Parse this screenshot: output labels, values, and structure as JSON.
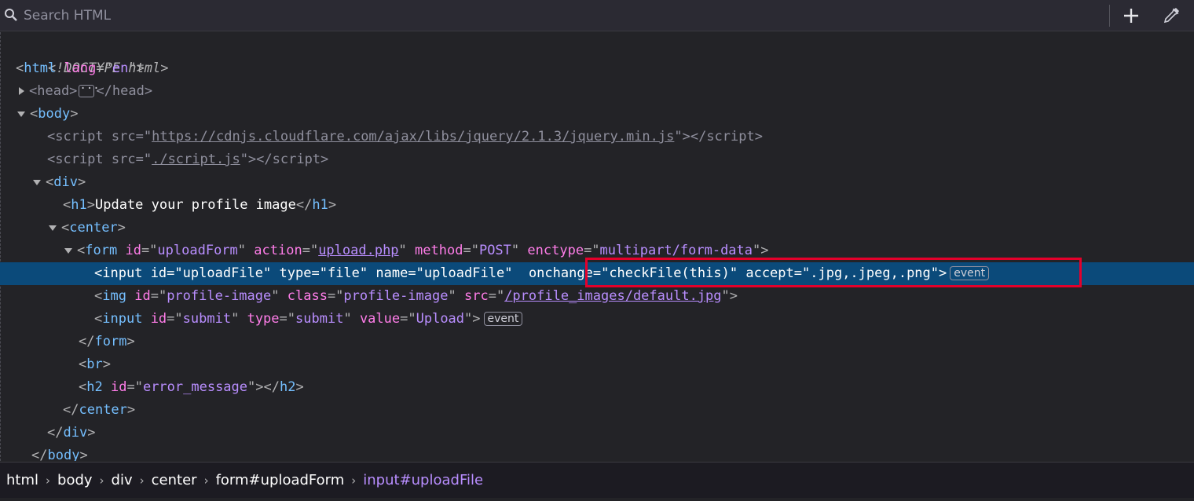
{
  "toolbar": {
    "search_placeholder": "Search HTML",
    "add_label": "+",
    "icons": [
      "search-icon",
      "add-icon",
      "eyedropper-icon"
    ]
  },
  "tree": {
    "doctype": "<!DOCTYPE html>",
    "html_open": "<html lang=\"en\">",
    "html_attr_name": "lang",
    "html_attr_value": "en",
    "head": {
      "open": "<head>",
      "close": "</head>"
    },
    "body_tag": "body",
    "script1": {
      "attr": "src",
      "value": "https://cdnjs.cloudflare.com/ajax/libs/jquery/2.1.3/jquery.min.js"
    },
    "script2": {
      "attr": "src",
      "value": "./script.js"
    },
    "div_tag": "div",
    "h1": {
      "tag": "h1",
      "text": "Update your profile image"
    },
    "center_tag": "center",
    "form": {
      "tag": "form",
      "attrs": [
        {
          "name": "id",
          "value": "uploadForm"
        },
        {
          "name": "action",
          "value": "upload.php"
        },
        {
          "name": "method",
          "value": "POST"
        },
        {
          "name": "enctype",
          "value": "multipart/form-data"
        }
      ]
    },
    "input_file": {
      "tag": "input",
      "attrs": [
        {
          "name": "id",
          "value": "uploadFile"
        },
        {
          "name": "type",
          "value": "file"
        },
        {
          "name": "name",
          "value": "uploadFile"
        },
        {
          "name": "onchange",
          "value": "checkFile(this)"
        },
        {
          "name": "accept",
          "value": ".jpg,.jpeg,.png"
        }
      ],
      "badge": "event"
    },
    "img": {
      "tag": "img",
      "attrs": [
        {
          "name": "id",
          "value": "profile-image"
        },
        {
          "name": "class",
          "value": "profile-image"
        },
        {
          "name": "src",
          "value": "/profile_images/default.jpg"
        }
      ]
    },
    "input_submit": {
      "tag": "input",
      "attrs": [
        {
          "name": "id",
          "value": "submit"
        },
        {
          "name": "type",
          "value": "submit"
        },
        {
          "name": "value",
          "value": "Upload"
        }
      ],
      "badge": "event"
    },
    "br_tag": "br",
    "h2": {
      "tag": "h2",
      "attr": "id",
      "value": "error_message"
    }
  },
  "breadcrumbs": [
    "html",
    "body",
    "div",
    "center",
    "form#uploadForm",
    "input#uploadFile"
  ],
  "colors": {
    "background": "#232327",
    "tag": "#75bfff",
    "attr_name": "#ff7de9",
    "attr_value": "#b98eff",
    "selection": "#0b4a7a",
    "highlight_box": "#e4002b"
  }
}
